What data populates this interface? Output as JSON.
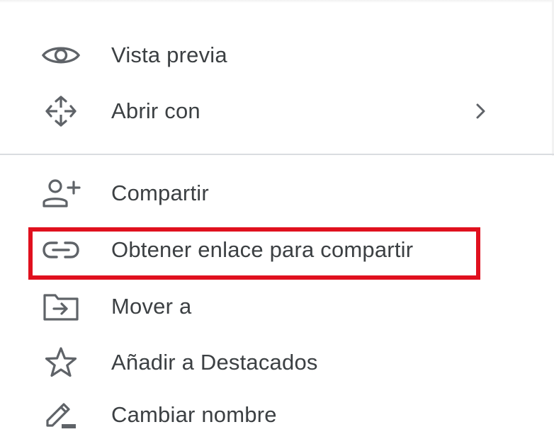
{
  "menu": {
    "items": [
      {
        "id": "preview",
        "label": "Vista previa",
        "icon": "eye-icon"
      },
      {
        "id": "open-with",
        "label": "Abrir con",
        "icon": "move-arrows-icon",
        "has_submenu": true
      },
      {
        "id": "share",
        "label": "Compartir",
        "icon": "add-person-icon"
      },
      {
        "id": "get-link",
        "label": "Obtener enlace para compartir",
        "icon": "link-icon",
        "highlighted": true
      },
      {
        "id": "move-to",
        "label": "Mover a",
        "icon": "folder-move-icon"
      },
      {
        "id": "add-starred",
        "label": "Añadir a Destacados",
        "icon": "star-icon"
      },
      {
        "id": "rename",
        "label": "Cambiar nombre",
        "icon": "pencil-icon"
      }
    ]
  },
  "colors": {
    "icon": "#5f6368",
    "text": "#3c4043",
    "divider": "#dadce0",
    "highlight": "#e0101e"
  }
}
